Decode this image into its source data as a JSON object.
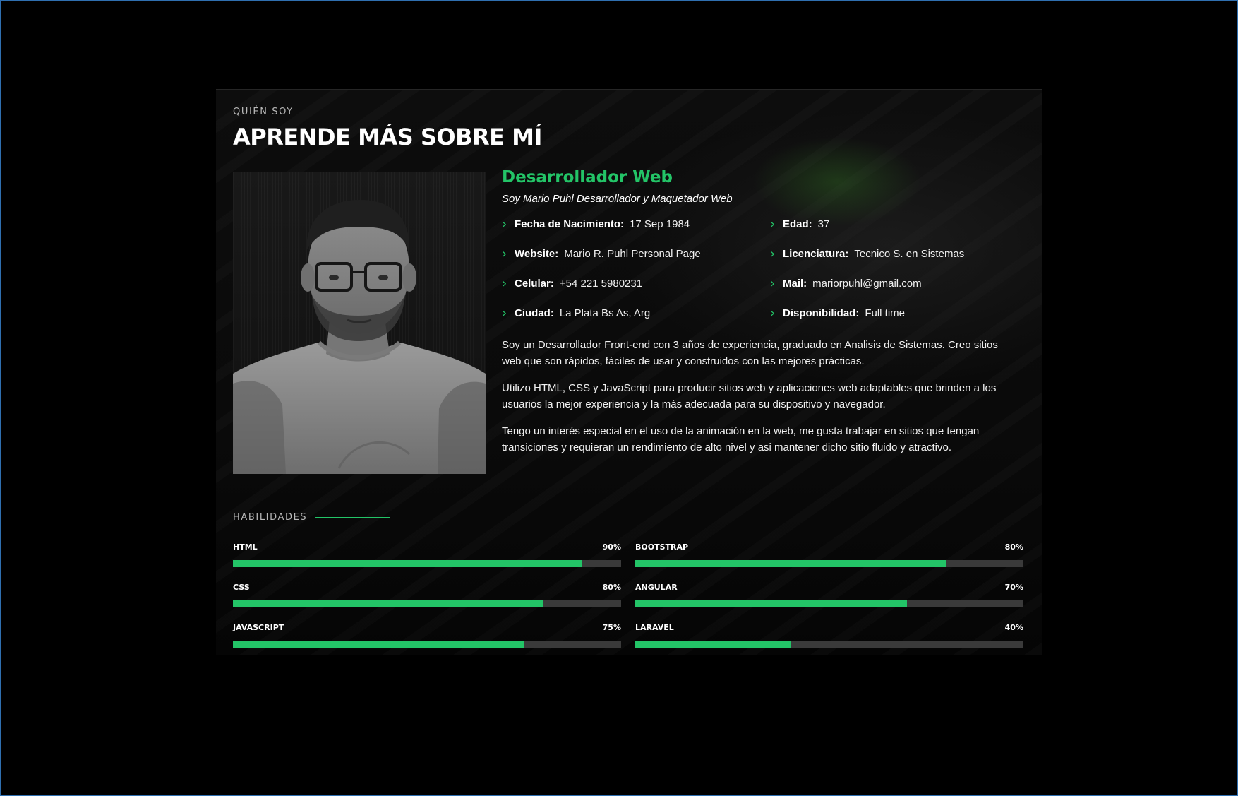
{
  "about": {
    "eyebrow": "QUIÉN SOY",
    "title": "APRENDE MÁS SOBRE MÍ"
  },
  "profile": {
    "role": "Desarrollador Web",
    "tagline": "Soy Mario Puhl Desarrollador y Maquetador Web",
    "details": [
      {
        "label": "Fecha de Nacimiento:",
        "value": "17 Sep 1984"
      },
      {
        "label": "Edad:",
        "value": "37"
      },
      {
        "label": "Website:",
        "value": "Mario R. Puhl Personal Page"
      },
      {
        "label": "Licenciatura:",
        "value": "Tecnico S. en Sistemas"
      },
      {
        "label": "Celular:",
        "value": "+54 221 5980231"
      },
      {
        "label": "Mail:",
        "value": "mariorpuhl@gmail.com"
      },
      {
        "label": "Ciudad:",
        "value": "La Plata Bs As, Arg"
      },
      {
        "label": "Disponibilidad:",
        "value": "Full time"
      }
    ],
    "paragraphs": [
      "Soy un Desarrollador Front-end con 3 años de experiencia, graduado en Analisis de Sistemas. Creo sitios web que son rápidos, fáciles de usar y construidos con las mejores prácticas.",
      "Utilizo HTML, CSS y JavaScript para producir sitios web y aplicaciones web adaptables que brinden a los usuarios la mejor experiencia y la más adecuada para su dispositivo y navegador.",
      "Tengo un interés especial en el uso de la animación en la web, me gusta trabajar en sitios que tengan transiciones y requieran un rendimiento de alto nivel y asi mantener dicho sitio fluido y atractivo."
    ]
  },
  "skills": {
    "eyebrow": "HABILIDADES",
    "items": [
      {
        "name": "HTML",
        "percent_label": "90%",
        "value": 90
      },
      {
        "name": "BOOTSTRAP",
        "percent_label": "80%",
        "value": 80
      },
      {
        "name": "CSS",
        "percent_label": "80%",
        "value": 80
      },
      {
        "name": "ANGULAR",
        "percent_label": "70%",
        "value": 70
      },
      {
        "name": "JAVASCRIPT",
        "percent_label": "75%",
        "value": 75
      },
      {
        "name": "LARAVEL",
        "percent_label": "40%",
        "value": 40
      }
    ]
  },
  "colors": {
    "accent": "#23c467",
    "track": "#3a3a3a",
    "background": "#000000"
  },
  "icons": {
    "detail_bullet": "chevron-right-icon"
  }
}
